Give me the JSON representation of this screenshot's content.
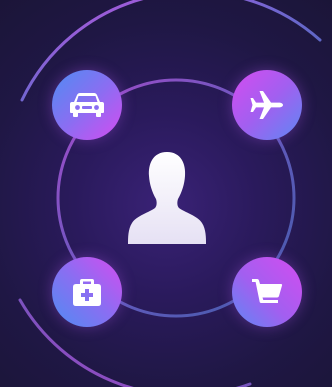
{
  "colors": {
    "background": "#2a1a5c",
    "node_gradient_start": "#d44cf0",
    "node_gradient_end": "#4f8cf3",
    "ring": "#9a7be6",
    "icon": "#ffffff"
  },
  "center": {
    "icon": "user-silhouette-icon"
  },
  "nodes": [
    {
      "icon": "car-icon"
    },
    {
      "icon": "airplane-icon"
    },
    {
      "icon": "medical-kit-icon"
    },
    {
      "icon": "shopping-cart-icon"
    }
  ]
}
